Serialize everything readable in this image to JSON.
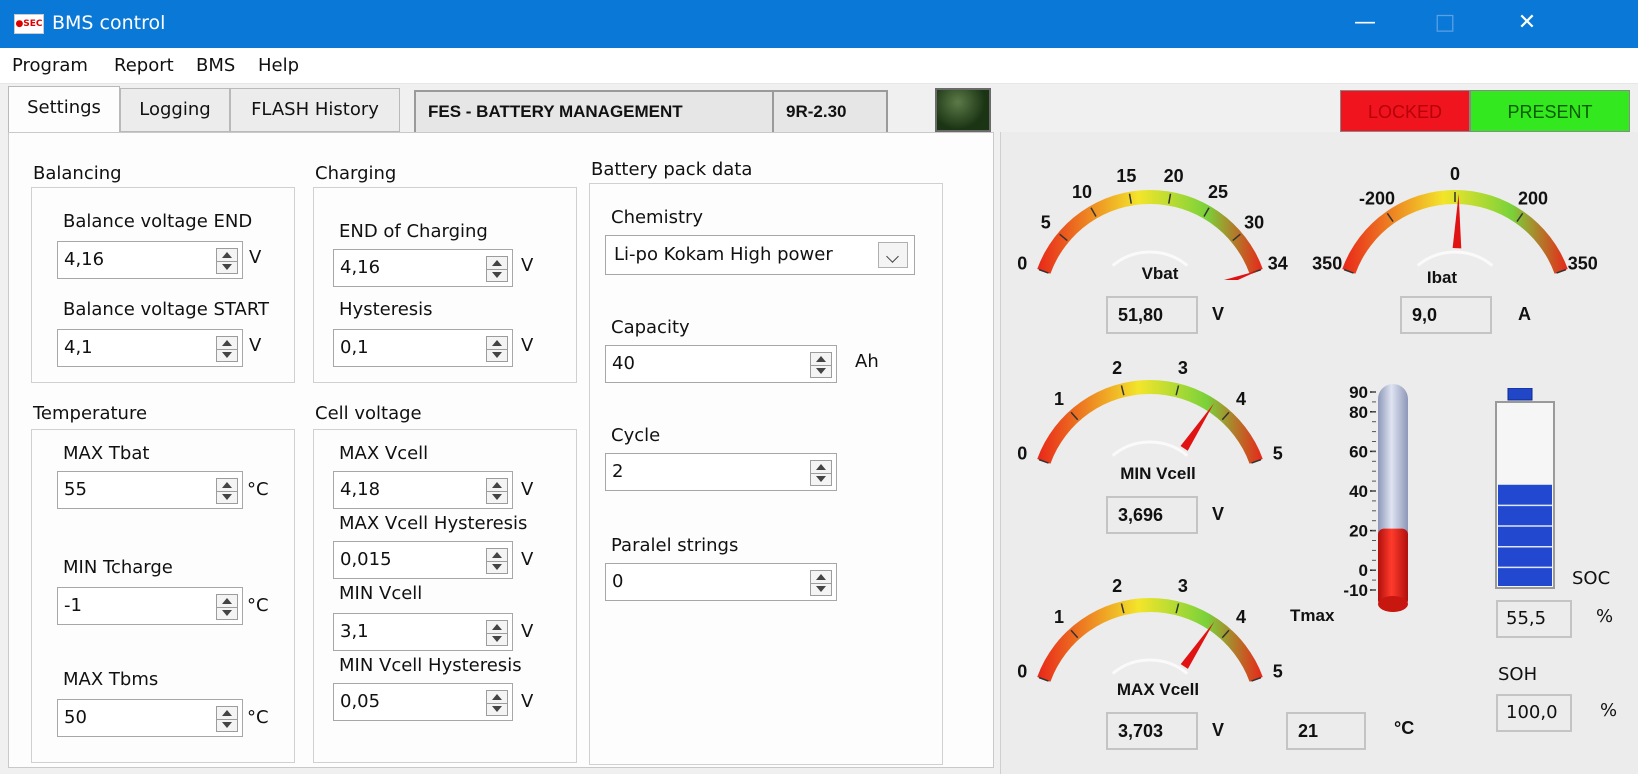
{
  "window": {
    "title": "BMS control",
    "app_icon_text": "●SEC"
  },
  "menu": [
    "Program",
    "Report",
    "BMS",
    "Help"
  ],
  "tabs": [
    {
      "label": "Settings",
      "active": true
    },
    {
      "label": "Logging",
      "active": false
    },
    {
      "label": "FLASH History",
      "active": false
    }
  ],
  "header": {
    "system_name": "FES - BATTERY MANAGEMENT",
    "version": "9R-2.30"
  },
  "status": {
    "locked": "LOCKED",
    "present": "PRESENT",
    "locked_color": "#f0141e",
    "present_color": "#33e81f"
  },
  "balancing": {
    "title": "Balancing",
    "end_label": "Balance voltage END",
    "end_value": "4,16",
    "end_unit": "V",
    "start_label": "Balance voltage START",
    "start_value": "4,1",
    "start_unit": "V"
  },
  "charging": {
    "title": "Charging",
    "end_label": "END of Charging",
    "end_value": "4,16",
    "end_unit": "V",
    "hyst_label": "Hysteresis",
    "hyst_value": "0,1",
    "hyst_unit": "V"
  },
  "temperature": {
    "title": "Temperature",
    "max_tbat_label": "MAX Tbat",
    "max_tbat_value": "55",
    "max_tbat_unit": "°C",
    "min_tcharge_label": "MIN Tcharge",
    "min_tcharge_value": "-1",
    "min_tcharge_unit": "°C",
    "max_tbms_label": "MAX Tbms",
    "max_tbms_value": "50",
    "max_tbms_unit": "°C"
  },
  "cell_voltage": {
    "title": "Cell voltage",
    "max_label": "MAX Vcell",
    "max_value": "4,18",
    "max_unit": "V",
    "max_hyst_label": "MAX Vcell Hysteresis",
    "max_hyst_value": "0,015",
    "max_hyst_unit": "V",
    "min_label": "MIN Vcell",
    "min_value": "3,1",
    "min_unit": "V",
    "min_hyst_label": "MIN Vcell Hysteresis",
    "min_hyst_value": "0,05",
    "min_hyst_unit": "V"
  },
  "battery_pack": {
    "title": "Battery pack data",
    "chemistry_label": "Chemistry",
    "chemistry_value": "Li-po Kokam High power",
    "capacity_label": "Capacity",
    "capacity_value": "40",
    "capacity_unit": "Ah",
    "cycle_label": "Cycle",
    "cycle_value": "2",
    "parallel_label": "Paralel strings",
    "parallel_value": "0"
  },
  "gauges": [
    {
      "id": "vbat",
      "label": "Vbat",
      "value_text": "51,80",
      "unit": "V",
      "min": 0,
      "max": 34,
      "needle": 34,
      "ticks": [
        "0",
        "5",
        "10",
        "15",
        "20",
        "25",
        "30",
        "34"
      ]
    },
    {
      "id": "ibat",
      "label": "Ibat",
      "value_text": "9,0",
      "unit": "A",
      "min": -350,
      "max": 350,
      "needle": 9.0,
      "ticks": [
        "350",
        "-200",
        "0",
        "200",
        "350"
      ]
    },
    {
      "id": "minvcell",
      "label": "MIN Vcell",
      "value_text": "3,696",
      "unit": "V",
      "min": 0,
      "max": 5,
      "needle": 3.696,
      "ticks": [
        "0",
        "1",
        "2",
        "3",
        "4",
        "5"
      ]
    },
    {
      "id": "maxvcell",
      "label": "MAX Vcell",
      "value_text": "3,703",
      "unit": "V",
      "min": 0,
      "max": 5,
      "needle": 3.703,
      "ticks": [
        "0",
        "1",
        "2",
        "3",
        "4",
        "5"
      ]
    }
  ],
  "thermometer": {
    "label": "Tmax",
    "value_text": "21",
    "unit": "°C",
    "level": 21,
    "ticks": [
      "90",
      "80",
      "60",
      "40",
      "20",
      "0",
      "-10"
    ]
  },
  "soc": {
    "label": "SOC",
    "value_text": "55,5",
    "unit": "%",
    "fraction": 0.555
  },
  "soh": {
    "label": "SOH",
    "value_text": "100,0",
    "unit": "%"
  }
}
